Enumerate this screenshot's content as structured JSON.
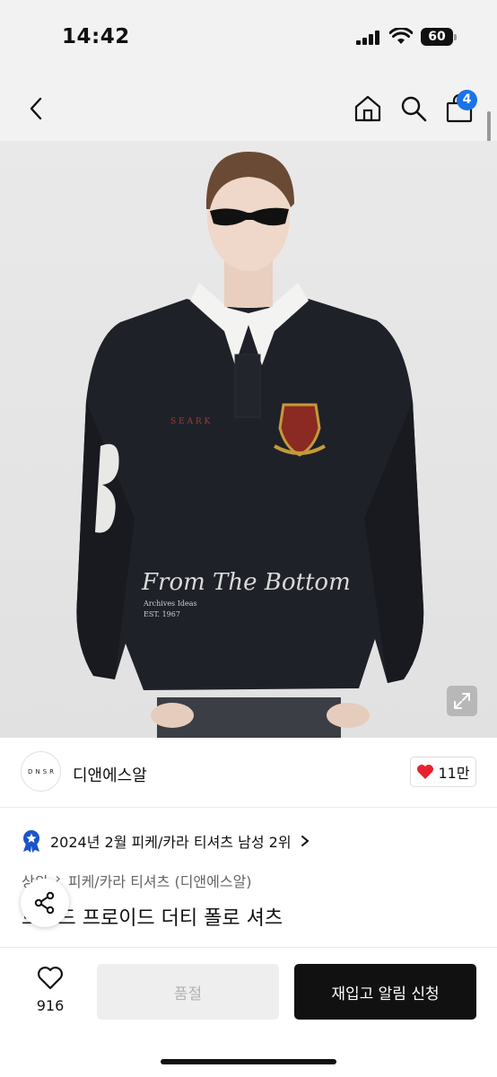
{
  "status_bar": {
    "time": "14:42",
    "battery": "60"
  },
  "header": {
    "cart_count": "4"
  },
  "brand": {
    "logo_text": "DNSR",
    "name": "디앤에스알",
    "likes": "11만"
  },
  "product": {
    "rank": "2024년 2월 피케/카라 티셔츠 남성 2위",
    "breadcrumb": [
      "상의",
      "피케/카라 티셔츠 (디앤에스알)"
    ],
    "title": "브로드 프로이드 더티 폴로 셔츠",
    "image_texts": {
      "script": "From The Bottom",
      "sub1": "Archives Ideas",
      "sub2": "EST. 1967",
      "chest": "S E A R K"
    }
  },
  "bottom": {
    "wish_count": "916",
    "soldout_label": "품절",
    "restock_label": "재입고 알림 신청"
  },
  "colors": {
    "accent": "#1a73e8",
    "heart": "#e8222e",
    "primary_button": "#111111"
  }
}
